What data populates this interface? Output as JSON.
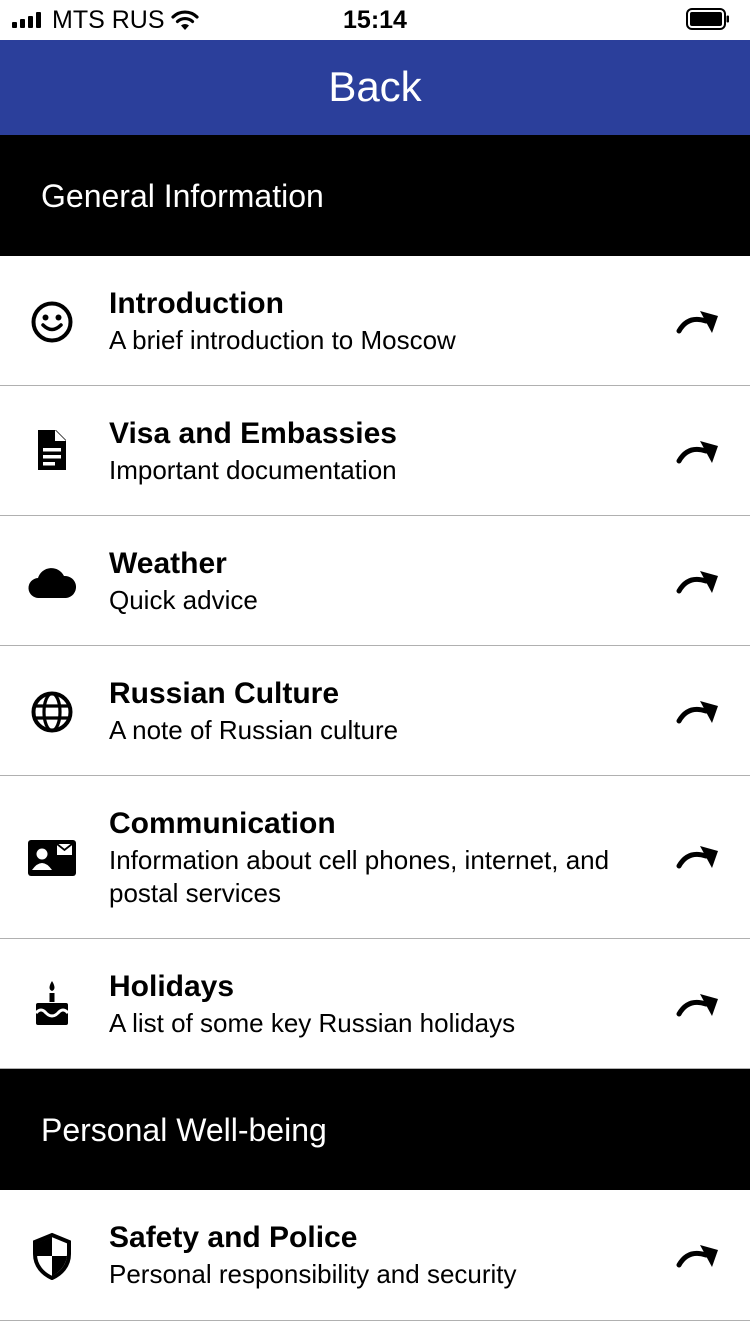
{
  "status_bar": {
    "carrier": "MTS RUS",
    "time": "15:14"
  },
  "nav": {
    "back_label": "Back",
    "color": "#2b3f9b"
  },
  "sections": [
    {
      "title": "General Information",
      "items": [
        {
          "title": "Introduction",
          "subtitle": "A brief introduction to Moscow",
          "icon": "smiley-icon"
        },
        {
          "title": "Visa and Embassies",
          "subtitle": "Important documentation",
          "icon": "document-icon"
        },
        {
          "title": "Weather",
          "subtitle": "Quick advice",
          "icon": "cloud-icon"
        },
        {
          "title": "Russian Culture",
          "subtitle": "A note of Russian culture",
          "icon": "globe-icon"
        },
        {
          "title": "Communication",
          "subtitle": "Information about cell phones, internet, and postal services",
          "icon": "contact-card-icon"
        },
        {
          "title": "Holidays",
          "subtitle": "A list of some key Russian holidays",
          "icon": "cake-icon"
        }
      ]
    },
    {
      "title": "Personal Well-being",
      "items": [
        {
          "title": "Safety and Police",
          "subtitle": "Personal responsibility and security",
          "icon": "shield-icon"
        }
      ]
    }
  ]
}
